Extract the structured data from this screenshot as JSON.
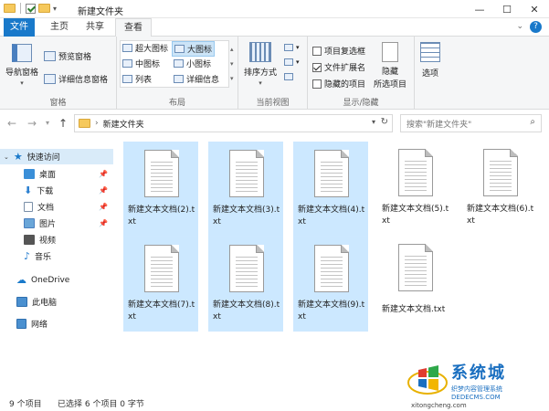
{
  "window": {
    "title": "新建文件夹"
  },
  "window_controls": {
    "minimize": "—",
    "maximize": "☐",
    "close": "✕"
  },
  "tabs": [
    "文件",
    "主页",
    "共享",
    "查看"
  ],
  "ribbon": {
    "panes": {
      "nav_pane": "导航窗格",
      "preview_pane": "预览窗格",
      "details_pane": "详细信息窗格",
      "group_label": "窗格"
    },
    "layout": {
      "xl_icons": "超大图标",
      "large_icons": "大图标",
      "medium_icons": "中图标",
      "small_icons": "小图标",
      "list": "列表",
      "details": "详细信息",
      "group_label": "布局"
    },
    "current_view": {
      "sort_by": "排序方式",
      "group_label": "当前视图"
    },
    "show_hide": {
      "item_checkboxes": "项目复选框",
      "file_ext": "文件扩展名",
      "hidden_items": "隐藏的项目",
      "hide_selected": "隐藏",
      "hide_selected_2": "所选项目",
      "group_label": "显示/隐藏"
    },
    "options": {
      "label": "选项"
    }
  },
  "address": {
    "path": "新建文件夹",
    "search_placeholder": "搜索\"新建文件夹\""
  },
  "nav": {
    "quick_access": "快速访问",
    "items": [
      "桌面",
      "下载",
      "文档",
      "图片",
      "视频",
      "音乐"
    ],
    "onedrive": "OneDrive",
    "this_pc": "此电脑",
    "network": "网络"
  },
  "files": [
    {
      "name": "新建文本文档(2).txt",
      "selected": true
    },
    {
      "name": "新建文本文档(3).txt",
      "selected": true
    },
    {
      "name": "新建文本文档(4).txt",
      "selected": true
    },
    {
      "name": "新建文本文档(5).txt",
      "selected": false
    },
    {
      "name": "新建文本文档(6).txt",
      "selected": false
    },
    {
      "name": "新建文本文档(7).txt",
      "selected": true
    },
    {
      "name": "新建文本文档(8).txt",
      "selected": true
    },
    {
      "name": "新建文本文档(9).txt",
      "selected": true
    },
    {
      "name": "新建文本文档.txt",
      "selected": false
    }
  ],
  "status": {
    "count": "9 个项目",
    "selected": "已选择 6 个项目 0 字节"
  },
  "watermark": {
    "big": "系统城",
    "small": "织梦内容管理系统",
    "url": "xitongcheng.com",
    "site": "DEDECMS.COM"
  }
}
